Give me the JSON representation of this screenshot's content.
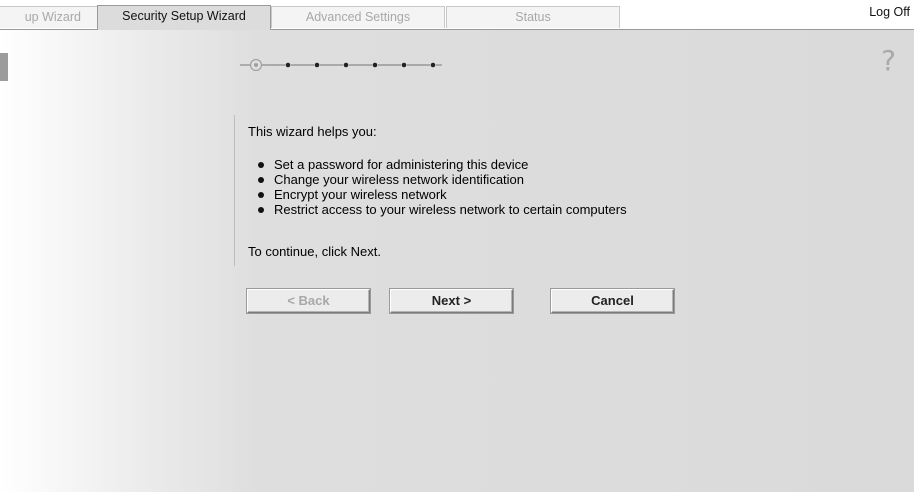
{
  "tabs": [
    {
      "label": "up Wizard",
      "state": "inactive"
    },
    {
      "label": "Security Setup Wizard",
      "state": "active"
    },
    {
      "label": "Advanced Settings",
      "state": "inactive"
    },
    {
      "label": "Status",
      "state": "inactive"
    }
  ],
  "header": {
    "logoff_label": "Log Off"
  },
  "help": {
    "glyph": "?",
    "icon": "help-icon"
  },
  "progress": {
    "current_step": 1,
    "total_steps": 7,
    "icon": "step-progress-indicator"
  },
  "wizard": {
    "intro": "This wizard helps you:",
    "bullets": [
      "Set a password for administering this device",
      "Change your wireless network identification",
      "Encrypt your wireless network",
      "Restrict access to your wireless network to certain computers"
    ],
    "continue_text": "To continue, click Next."
  },
  "buttons": {
    "back_label": "< Back",
    "back_enabled": false,
    "next_label": "Next >",
    "cancel_label": "Cancel"
  },
  "colors": {
    "panel_bg": "#dadada",
    "active_tab_bg": "#dcdcdc",
    "inactive_tab_text": "#a8a8a8"
  }
}
